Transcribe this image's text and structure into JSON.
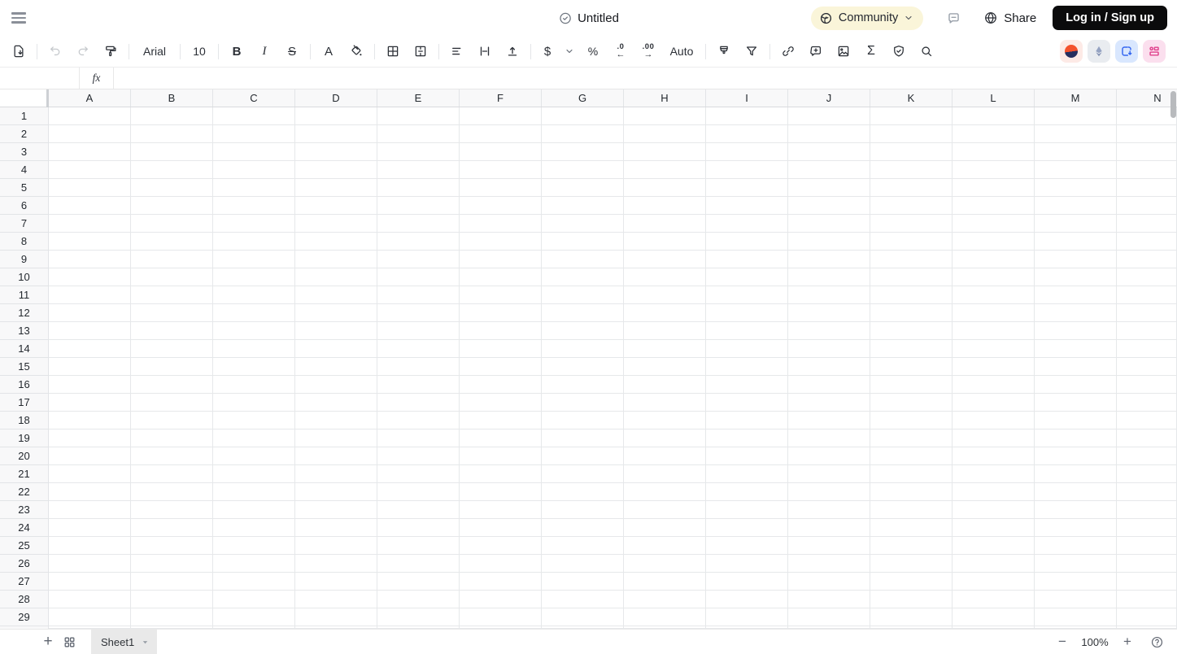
{
  "topbar": {
    "title": "Untitled",
    "community_label": "Community",
    "share_label": "Share",
    "login_label": "Log in / Sign up"
  },
  "toolbar": {
    "font_family": "Arial",
    "font_size": "10",
    "bold_glyph": "B",
    "italic_glyph": "I",
    "strikethrough_glyph": "S",
    "font_color_glyph": "A",
    "currency_glyph": "$",
    "percent_glyph": "%",
    "decrease_decimal_label": ".0",
    "decrease_decimal_arrow": "←",
    "increase_decimal_label": ".00",
    "increase_decimal_arrow": "→",
    "number_format_label": "Auto",
    "sum_glyph": "Σ"
  },
  "formula_bar": {
    "name_box_value": "",
    "fx_label": "fx",
    "input_value": ""
  },
  "grid": {
    "columns": [
      "A",
      "B",
      "C",
      "D",
      "E",
      "F",
      "G",
      "H",
      "I",
      "J",
      "K",
      "L",
      "M",
      "N"
    ],
    "rows": [
      "1",
      "2",
      "3",
      "4",
      "5",
      "6",
      "7",
      "8",
      "9",
      "10",
      "11",
      "12",
      "13",
      "14",
      "15",
      "16",
      "17",
      "18",
      "19",
      "20",
      "21",
      "22",
      "23",
      "24",
      "25",
      "26",
      "27",
      "28",
      "29"
    ]
  },
  "footer": {
    "add_sheet_glyph": "+",
    "sheet_tab_label": "Sheet1",
    "zoom_out_glyph": "−",
    "zoom_level": "100%",
    "zoom_in_glyph": "+",
    "help_glyph": "?"
  },
  "colors": {
    "community_bg": "#faf5d9",
    "login_bg": "#0b0b0c",
    "header_bg": "#f8f8f9",
    "grid_line": "#e6e8ea",
    "plugin_sunset_bg": "#fdeae6",
    "plugin_sunset_top": "#f4512c",
    "plugin_sunset_bottom": "#262e5e",
    "plugin_ethereum_bg": "#e9ecf0",
    "plugin_ethereum_fg": "#8b9bbd",
    "plugin_export_bg": "#d9e7fe",
    "plugin_export_fg": "#3467f0",
    "plugin_layout_bg": "#fbdfee",
    "plugin_layout_fg": "#e0408c"
  },
  "icons": [
    "hamburger-icon",
    "doc-status-icon",
    "community-globe-icon",
    "chevron-down-icon",
    "comment-icon",
    "share-globe-icon",
    "file-download-icon",
    "undo-icon",
    "redo-icon",
    "format-painter-icon",
    "text-color-icon",
    "fill-color-icon",
    "borders-icon",
    "merge-cells-icon",
    "align-left-icon",
    "vertical-align-icon",
    "text-overflow-icon",
    "currency-icon",
    "percent-icon",
    "decrease-decimal-icon",
    "increase-decimal-icon",
    "theme-format-icon",
    "filter-icon",
    "link-icon",
    "add-comment-icon",
    "image-icon",
    "sum-icon",
    "protect-icon",
    "search-icon",
    "sunset-plugin-icon",
    "ethereum-plugin-icon",
    "export-plugin-icon",
    "layout-plugin-icon",
    "add-sheet-icon",
    "all-sheets-icon",
    "zoom-out-icon",
    "zoom-in-icon",
    "help-icon",
    "vertical-scrollbar"
  ]
}
